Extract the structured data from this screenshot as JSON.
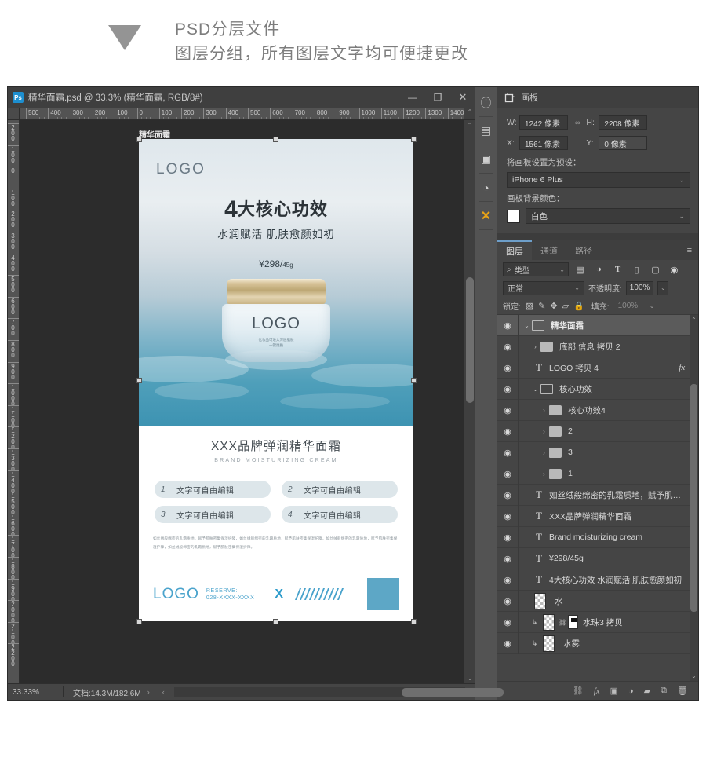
{
  "banner": {
    "arrow_icon": "triangle-down-icon",
    "line1": "PSD分层文件",
    "line2": "图层分组，所有图层文字均可便捷更改"
  },
  "document_window": {
    "app_badge": "Ps",
    "title": "精华面霜.psd @ 33.3% (精华面霜, RGB/8#)",
    "minimize": "—",
    "maximize": "❐",
    "close": "✕",
    "ruler_h_ticks": [
      "500",
      "400",
      "300",
      "200",
      "100",
      "0",
      "100",
      "200",
      "300",
      "400",
      "500",
      "600",
      "700",
      "800",
      "900",
      "1000",
      "1100",
      "1200",
      "1300",
      "1400"
    ],
    "ruler_v_ticks": [
      "200",
      "100",
      "0",
      "100",
      "200",
      "300",
      "400",
      "500",
      "600",
      "700",
      "800",
      "900",
      "1000",
      "1100",
      "1200",
      "1300",
      "1400",
      "1500",
      "1600",
      "1700",
      "1800",
      "1900",
      "2000",
      "2100",
      "2200"
    ],
    "artboard_label": "精华面霜"
  },
  "poster": {
    "logo": "LOGO",
    "title_number": "4",
    "title_text": "大核心功效",
    "subtitle": "水润赋活  肌肤愈颜如初",
    "price": "¥298/",
    "price_unit": "45g",
    "jar_logo": "LOGO",
    "jar_line1": "化妆品可进入深层肌肤",
    "jar_line2": "一键更换",
    "product_name": "XXX品牌弹润精华面霜",
    "product_name_en": "BRAND MOISTURIZING CREAM",
    "features": [
      {
        "num": "1.",
        "text": "文字可自由编辑"
      },
      {
        "num": "2.",
        "text": "文字可自由编辑"
      },
      {
        "num": "3.",
        "text": "文字可自由编辑"
      },
      {
        "num": "4.",
        "text": "文字可自由编辑"
      }
    ],
    "paragraph": "如丝绒般绵密的乳霜质地，赋予肌肤密集保湿护障，如丝绒般绵密的乳霜质地，赋予肌肤密集保湿护障，如丝绒般绵密的乳霜质地，赋予肌肤密集保湿护障，如丝绒般绵密的乳霜质地，赋予肌肤密集保湿护障。",
    "footer_logo": "LOGO",
    "footer_reserve_label": "RESERVE:",
    "footer_phone": "028-XXXX-XXXX",
    "footer_x": "X"
  },
  "statusbar": {
    "zoom": "33.33%",
    "doc_info": "文档:14.3M/182.6M",
    "expand_arrow": "›",
    "left_arrow": "‹",
    "right_arrow": "›"
  },
  "icon_rail": [
    {
      "name": "info-icon",
      "glyph": "ⓘ"
    },
    {
      "name": "history-icon",
      "glyph": "▤"
    },
    {
      "name": "notes-icon",
      "glyph": "▣"
    },
    {
      "name": "3d-icon",
      "glyph": "◔"
    },
    {
      "name": "tools-icon",
      "glyph": "✕"
    }
  ],
  "properties_panel": {
    "icon": "artboard-icon",
    "title": "画板",
    "w_label": "W:",
    "w_value": "1242 像素",
    "link_icon": "link-icon",
    "h_label": "H:",
    "h_value": "2208 像素",
    "x_label": "X:",
    "x_value": "1561 像素",
    "y_label": "Y:",
    "y_value": "0 像素",
    "preset_label": "将画板设置为预设：",
    "preset_value": "iPhone 6 Plus",
    "bgcolor_label": "画板背景颜色：",
    "bgcolor_value": "白色",
    "bgcolor_swatch": "#ffffff"
  },
  "layers_panel": {
    "tabs": [
      {
        "label": "图层",
        "active": true
      },
      {
        "label": "通道",
        "active": false
      },
      {
        "label": "路径",
        "active": false
      }
    ],
    "menu_icon": "panel-menu-icon",
    "filter": {
      "search_icon": "search-icon",
      "value": "类型",
      "icons": [
        "image-filter-icon",
        "adjustment-filter-icon",
        "text-filter-icon",
        "shape-filter-icon",
        "smartobject-filter-icon",
        "filter-toggle-icon"
      ]
    },
    "blend_mode": "正常",
    "opacity_label": "不透明度:",
    "opacity_value": "100%",
    "lock_label": "锁定:",
    "lock_icons": [
      "lock-transparent-icon",
      "lock-image-icon",
      "lock-position-icon",
      "lock-artboard-icon",
      "lock-all-icon"
    ],
    "fill_label": "填充:",
    "fill_value": "100%",
    "rows": [
      {
        "name": "精华面霜",
        "type": "group-open",
        "indent": 0,
        "selected": true,
        "bold": true,
        "eye": true
      },
      {
        "name": "底部 信息 拷贝 2",
        "type": "group",
        "indent": 1,
        "selected": false,
        "bold": false,
        "eye": true
      },
      {
        "name": "LOGO 拷贝 4",
        "type": "text",
        "indent": 1,
        "selected": false,
        "bold": false,
        "eye": true,
        "fx": "fx"
      },
      {
        "name": "核心功效",
        "type": "group-open",
        "indent": 1,
        "selected": false,
        "bold": false,
        "eye": true
      },
      {
        "name": "核心功效4",
        "type": "group",
        "indent": 2,
        "selected": false,
        "bold": false,
        "eye": true
      },
      {
        "name": "2",
        "type": "group",
        "indent": 2,
        "selected": false,
        "bold": false,
        "eye": true
      },
      {
        "name": "3",
        "type": "group",
        "indent": 2,
        "selected": false,
        "bold": false,
        "eye": true
      },
      {
        "name": "1",
        "type": "group",
        "indent": 2,
        "selected": false,
        "bold": false,
        "eye": true
      },
      {
        "name": "如丝绒般绵密的乳霜质地，赋予肌…",
        "type": "text",
        "indent": 1,
        "selected": false,
        "bold": false,
        "eye": true
      },
      {
        "name": "XXX品牌弹润精华面霜",
        "type": "text",
        "indent": 1,
        "selected": false,
        "bold": false,
        "eye": true
      },
      {
        "name": "Brand moisturizing cream",
        "type": "text",
        "indent": 1,
        "selected": false,
        "bold": false,
        "eye": true
      },
      {
        "name": "¥298/45g",
        "type": "text",
        "indent": 1,
        "selected": false,
        "bold": false,
        "eye": true
      },
      {
        "name": "4大核心功效  水润赋活  肌肤愈颜如初",
        "type": "text",
        "indent": 1,
        "selected": false,
        "bold": false,
        "eye": true
      },
      {
        "name": "水",
        "type": "pixel",
        "indent": 1,
        "selected": false,
        "bold": false,
        "eye": true
      },
      {
        "name": "水珠3 拷贝",
        "type": "pixel-masked",
        "indent": 1,
        "selected": false,
        "bold": false,
        "eye": true,
        "clipped": true
      },
      {
        "name": "水雾",
        "type": "pixel",
        "indent": 1,
        "selected": false,
        "bold": false,
        "eye": true,
        "clipped": true
      }
    ],
    "footer_icons": [
      {
        "name": "link-layers-icon",
        "glyph": "⛓"
      },
      {
        "name": "layer-style-fx-icon",
        "glyph": "fx"
      },
      {
        "name": "add-mask-icon",
        "glyph": "▣"
      },
      {
        "name": "adjustment-layer-icon",
        "glyph": "◑"
      },
      {
        "name": "new-group-icon",
        "glyph": "▰"
      },
      {
        "name": "new-layer-icon",
        "glyph": "⧉"
      },
      {
        "name": "delete-layer-icon",
        "glyph": "🗑"
      }
    ]
  }
}
